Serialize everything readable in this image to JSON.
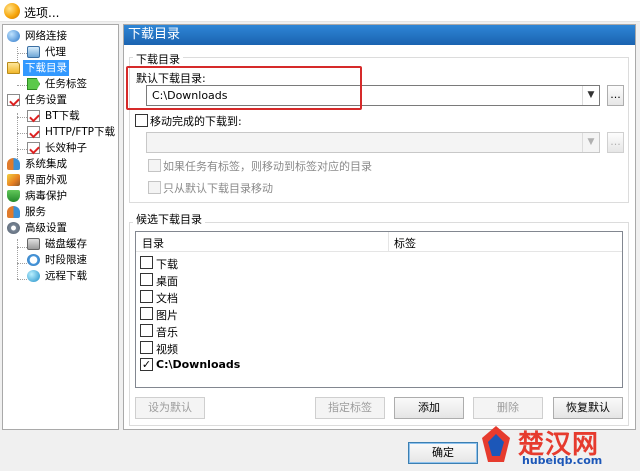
{
  "window": {
    "title": "选项..."
  },
  "sidebar": {
    "items": [
      {
        "label": "网络连接",
        "icon": "globe-icon"
      },
      {
        "label": "代理",
        "icon": "proxy-icon"
      },
      {
        "label": "下载目录",
        "icon": "folder-icon",
        "selected": true
      },
      {
        "label": "任务标签",
        "icon": "tag-icon"
      },
      {
        "label": "任务设置",
        "icon": "task-icon"
      },
      {
        "label": "BT下载",
        "icon": "task-icon"
      },
      {
        "label": "HTTP/FTP下载",
        "icon": "task-icon"
      },
      {
        "label": "长效种子",
        "icon": "task-icon"
      },
      {
        "label": "系统集成",
        "icon": "people-icon"
      },
      {
        "label": "界面外观",
        "icon": "brush-icon"
      },
      {
        "label": "病毒保护",
        "icon": "shield-icon"
      },
      {
        "label": "服务",
        "icon": "people-icon"
      },
      {
        "label": "高级设置",
        "icon": "gear-icon"
      },
      {
        "label": "磁盘缓存",
        "icon": "disk-icon"
      },
      {
        "label": "时段限速",
        "icon": "clock-icon"
      },
      {
        "label": "远程下载",
        "icon": "remote-icon"
      }
    ]
  },
  "panel": {
    "header": "下载目录",
    "download_dir": {
      "group_title": "下载目录",
      "default_label": "默认下载目录:",
      "default_value": "C:\\Downloads",
      "browse_label": "...",
      "move_label": "移动完成的下载到:",
      "move_checked": false,
      "move_value": "",
      "tag_option_label": "如果任务有标签，则移动到标签对应的目录",
      "only_default_label": "只从默认下载目录移动"
    },
    "candidates": {
      "group_title": "候选下载目录",
      "columns": [
        "目录",
        "标签"
      ],
      "rows": [
        {
          "label": "下载",
          "checked": false,
          "bold": false
        },
        {
          "label": "桌面",
          "checked": false,
          "bold": false
        },
        {
          "label": "文档",
          "checked": false,
          "bold": false
        },
        {
          "label": "图片",
          "checked": false,
          "bold": false
        },
        {
          "label": "音乐",
          "checked": false,
          "bold": false
        },
        {
          "label": "视频",
          "checked": false,
          "bold": false
        },
        {
          "label": "C:\\Downloads",
          "checked": true,
          "bold": true
        }
      ],
      "buttons": {
        "set_default": "设为默认",
        "assign_tag": "指定标签",
        "add": "添加",
        "delete": "删除",
        "restore_default": "恢复默认"
      }
    }
  },
  "footer": {
    "ok_label": "确定"
  },
  "watermark": {
    "brand": "楚汉网",
    "url": "hubeiqb.com"
  },
  "colors": {
    "accent": "#1a63b0",
    "selection": "#3399ff",
    "highlight": "#d62a2a"
  }
}
